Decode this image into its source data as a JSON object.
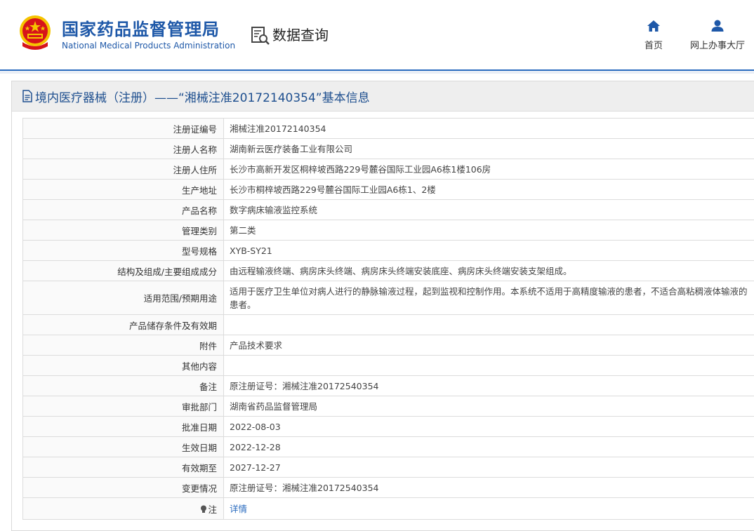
{
  "header": {
    "logo_cn": "国家药品监督管理局",
    "logo_en": "National Medical Products Administration",
    "data_query": "数据查询",
    "nav": {
      "home": "首页",
      "service_hall": "网上办事大厅"
    }
  },
  "panel": {
    "title": "境内医疗器械（注册）——“湘械注准20172140354”基本信息"
  },
  "rows": [
    {
      "key": "注册证编号",
      "value": "湘械注准20172140354"
    },
    {
      "key": "注册人名称",
      "value": "湖南新云医疗装备工业有限公司"
    },
    {
      "key": "注册人住所",
      "value": "长沙市高新开发区桐梓坡西路229号麓谷国际工业园A6栋1楼106房"
    },
    {
      "key": "生产地址",
      "value": "长沙市桐梓坡西路229号麓谷国际工业园A6栋1、2楼"
    },
    {
      "key": "产品名称",
      "value": "数字病床输液监控系统"
    },
    {
      "key": "管理类别",
      "value": "第二类"
    },
    {
      "key": "型号规格",
      "value": "XYB-SY21"
    },
    {
      "key": "结构及组成/主要组成成分",
      "value": "由远程输液终端、病房床头终端、病房床头终端安装底座、病房床头终端安装支架组成。"
    },
    {
      "key": "适用范围/预期用途",
      "value": "适用于医疗卫生单位对病人进行的静脉输液过程，起到监视和控制作用。本系统不适用于高精度输液的患者，不适合高粘稠液体输液的患者。"
    },
    {
      "key": "产品储存条件及有效期",
      "value": ""
    },
    {
      "key": "附件",
      "value": "产品技术要求"
    },
    {
      "key": "其他内容",
      "value": ""
    },
    {
      "key": "备注",
      "value": "原注册证号：湘械注准20172540354"
    },
    {
      "key": "审批部门",
      "value": "湖南省药品监督管理局"
    },
    {
      "key": "批准日期",
      "value": "2022-08-03"
    },
    {
      "key": "生效日期",
      "value": "2022-12-28"
    },
    {
      "key": "有效期至",
      "value": "2027-12-27"
    },
    {
      "key": "变更情况",
      "value": "原注册证号：湘械注准20172540354"
    }
  ],
  "note_row": {
    "key": "注",
    "link": "详情"
  },
  "colors": {
    "brand_blue": "#1e58a8",
    "link_blue": "#2a6bbf",
    "emblem_red": "#d7141a",
    "emblem_gold": "#f5c400"
  }
}
